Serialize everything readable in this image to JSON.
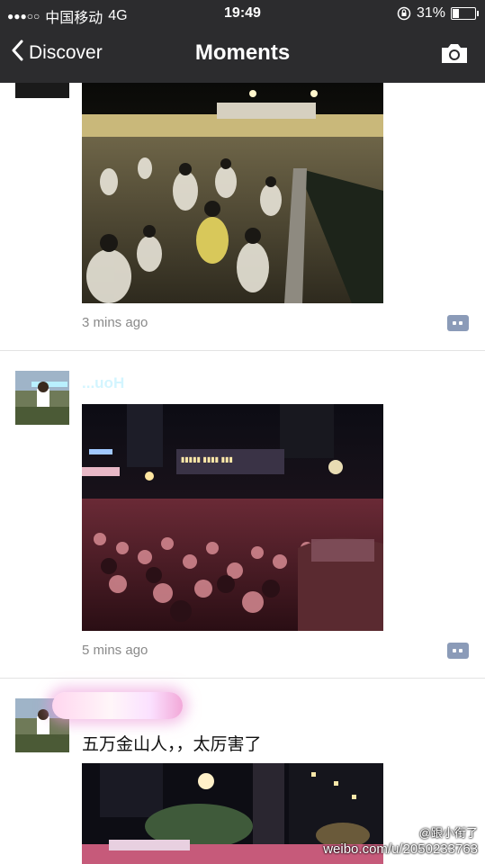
{
  "status_bar": {
    "signal_dots": "●●●○○",
    "carrier": "中国移动",
    "network": "4G",
    "time": "19:49",
    "battery_percent": "31%",
    "battery_level": 0.31
  },
  "nav": {
    "back_label": "Discover",
    "title": "Moments"
  },
  "posts": [
    {
      "timestamp": "3 mins ago"
    },
    {
      "username": "...uoH",
      "timestamp": "5 mins ago"
    },
    {
      "text": "五万金山人，，太厉害了"
    }
  ],
  "watermark": {
    "handle": "@跟小衔了",
    "url": "weibo.com/u/2050233763"
  },
  "colors": {
    "bar_bg": "#2c2c2e",
    "username": "#576b95",
    "timestamp": "#8a8a8a",
    "comment_btn": "#8b9bb8"
  },
  "icons": [
    "chevron-left-icon",
    "camera-icon",
    "lock-rotation-icon",
    "battery-icon",
    "comment-icon",
    "weibo-icon"
  ]
}
